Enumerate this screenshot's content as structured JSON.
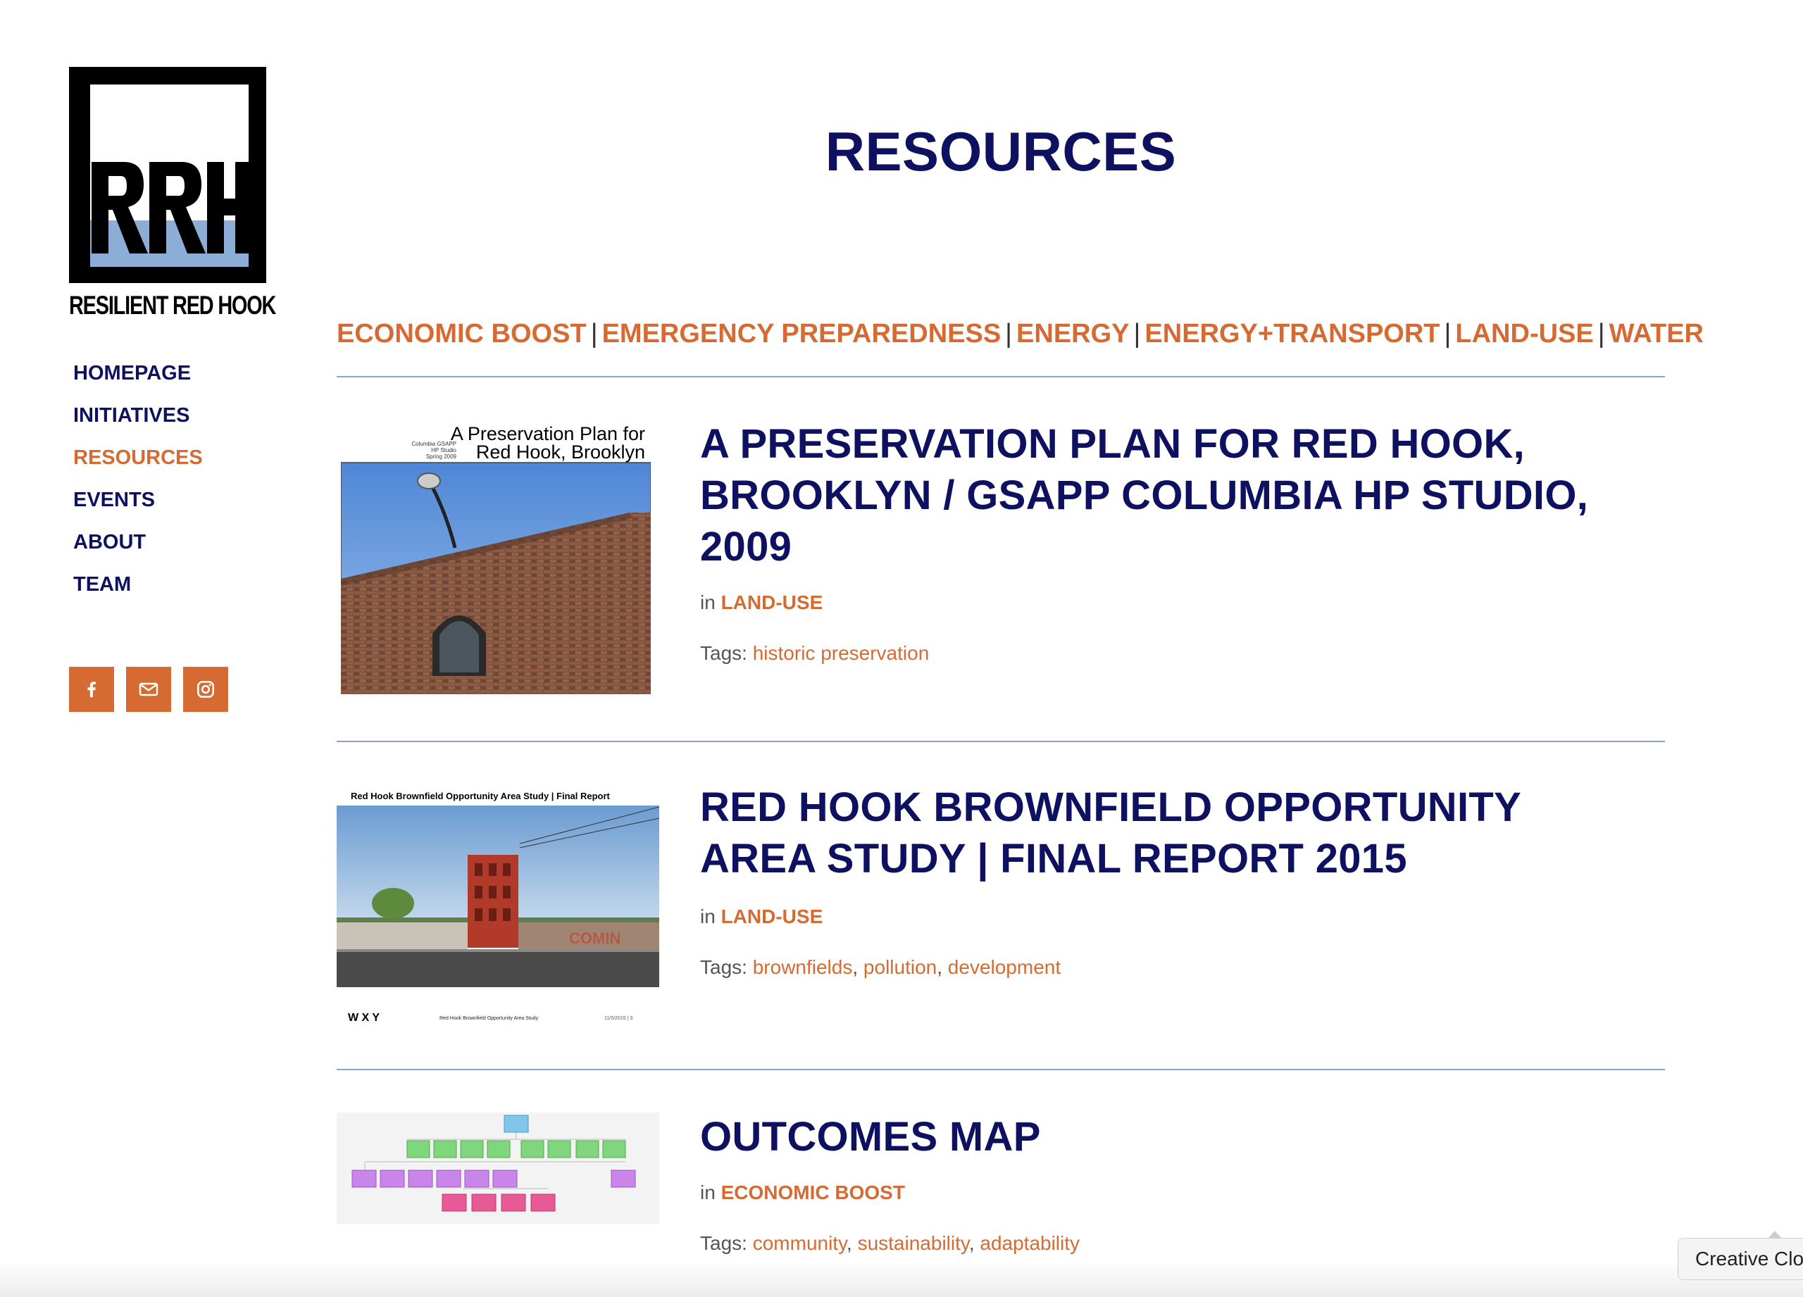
{
  "sidebar": {
    "logo_text": "RRH",
    "logo_caption": "RESILIENT RED HOOK",
    "nav": [
      {
        "label": "HOMEPAGE",
        "active": false
      },
      {
        "label": "INITIATIVES",
        "active": false
      },
      {
        "label": "RESOURCES",
        "active": true
      },
      {
        "label": "EVENTS",
        "active": false
      },
      {
        "label": "ABOUT",
        "active": false
      },
      {
        "label": "TEAM",
        "active": false
      }
    ],
    "social": [
      {
        "icon": "facebook-icon"
      },
      {
        "icon": "email-icon"
      },
      {
        "icon": "instagram-icon"
      }
    ]
  },
  "main": {
    "title": "RESOURCES",
    "categories": [
      "ECONOMIC BOOST",
      "EMERGENCY PREPAREDNESS",
      "ENERGY",
      "ENERGY+TRANSPORT",
      "LAND-USE",
      "WATER"
    ],
    "separator": "|",
    "in_label": "in",
    "tags_label": "Tags:",
    "posts": [
      {
        "title": "A PRESERVATION PLAN FOR RED HOOK, BROOKLYN / GSAPP COLUMBIA HP STUDIO, 2009",
        "category": "LAND-USE",
        "tags": [
          "historic preservation"
        ],
        "thumb": {
          "heading_line1": "A Preservation Plan for",
          "heading_line2": "Red Hook, Brooklyn",
          "small_lines": [
            "Columbia GSAPP",
            "HP Studio",
            "Spring 2009"
          ]
        }
      },
      {
        "title": "RED HOOK BROWNFIELD OPPORTUNITY AREA STUDY | FINAL REPORT 2015",
        "category": "LAND-USE",
        "tags": [
          "brownfields",
          "pollution",
          "development"
        ],
        "thumb": {
          "heading": "Red Hook Brownfield Opportunity Area Study | Final Report",
          "footer_left": "W X Y",
          "footer_mid": "Red Hook Brownfield Opportunity Area Study",
          "footer_right": "11/5/2015 | 3"
        }
      },
      {
        "title": "OUTCOMES MAP",
        "category": "ECONOMIC BOOST",
        "tags": [
          "community",
          "sustainability",
          "adaptability"
        ]
      }
    ]
  },
  "overlay": {
    "badge": "Creative Clo"
  },
  "colors": {
    "navy": "#0d1160",
    "orange": "#d56a32",
    "rule": "#8aa4c8",
    "logo_blue": "#8cadd6"
  }
}
